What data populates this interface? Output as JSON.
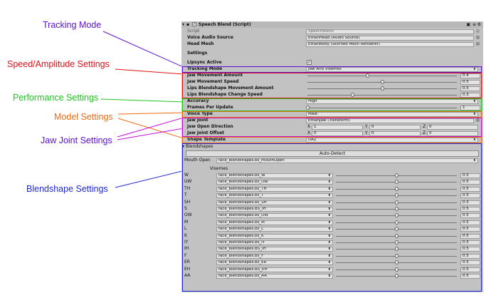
{
  "callouts": [
    {
      "id": "tracking",
      "text": "Tracking Mode",
      "color": "#5a0fd6"
    },
    {
      "id": "speed",
      "text": "Speed/Amplitude Settings",
      "color": "#e0121a"
    },
    {
      "id": "performance",
      "text": "Performance Settings",
      "color": "#21c421"
    },
    {
      "id": "model",
      "text": "Model Settings",
      "color": "#f06a11"
    },
    {
      "id": "jaw",
      "text": "Jaw Joint Settings",
      "color": "#5a0fd6"
    },
    {
      "id": "blend",
      "text": "Blendshape Settings",
      "color": "#1f2ad6"
    }
  ],
  "header": {
    "title": "Speech Blend (Script)",
    "enabled": true
  },
  "fields": {
    "script_label": "Script",
    "script_value": "SpeechBlend",
    "voice_source_label": "Voice Audio Source",
    "voice_source_value": "EthanHead (Audio Source)",
    "head_mesh_label": "Head Mesh",
    "head_mesh_value": "EthanBody (Skinned Mesh Renderer)",
    "settings_label": "Settings",
    "lipsync_label": "Lipsync Active",
    "lipsync_checked": true,
    "tracking_label": "Tracking Mode",
    "tracking_value": "Jaw And Visemes",
    "jaw_amount_label": "Jaw Movement Amount",
    "jaw_amount_value": "0.4",
    "jaw_speed_label": "Jaw Movement Speed",
    "jaw_speed_value": "0.5",
    "lips_amount_label": "Lips Blendshape Movement Amount",
    "lips_amount_value": "0.5",
    "lips_speed_label": "Lips Blendshape Change Speed",
    "lips_speed_value": "0.3",
    "accuracy_label": "Accuracy",
    "accuracy_value": "High",
    "frames_label": "Frames Per Update",
    "frames_value": "1",
    "voice_type_label": "Voice Type",
    "voice_type_value": "Male",
    "jaw_joint_label": "Jaw Joint",
    "jaw_joint_value": "EthanJaw (Transform)",
    "jaw_dir_label": "Jaw Open Direction",
    "jaw_dir_x": "1",
    "jaw_dir_y": "0",
    "jaw_dir_z": "0",
    "jaw_offset_label": "Jaw Joint Offset",
    "jaw_offset_x": "0",
    "jaw_offset_y": "0",
    "jaw_offset_z": "0",
    "shape_template_label": "Shape Template",
    "shape_template_value": "DAZ"
  },
  "blendshapes": {
    "foldout_label": "Blendshapes",
    "auto_detect_label": "Auto-Detect",
    "mouth_open_label": "Mouth Open",
    "mouth_open_value": "face_blendshapes.bs_mouthOpen",
    "visemes_label": "Visemes",
    "visemes": [
      {
        "name": "W",
        "shape": "face_blendshapes.bs_W",
        "value": "0.5"
      },
      {
        "name": "UW",
        "shape": "face_blendshapes.bs_UW",
        "value": "0.5"
      },
      {
        "name": "TH",
        "shape": "face_blendshapes.bs_TH",
        "value": "0.5"
      },
      {
        "name": "T",
        "shape": "face_blendshapes.bs_T",
        "value": "0.5"
      },
      {
        "name": "SH",
        "shape": "face_blendshapes.bs_SH",
        "value": "0.5"
      },
      {
        "name": "S",
        "shape": "face_blendshapes.BS_IH",
        "value": "0.5"
      },
      {
        "name": "OW",
        "shape": "face_blendshapes.bs_OW",
        "value": "0.5"
      },
      {
        "name": "M",
        "shape": "face_blendshapes.bs_M",
        "value": "0.5"
      },
      {
        "name": "L",
        "shape": "face_blendshapes.bs_L",
        "value": "0.5"
      },
      {
        "name": "K",
        "shape": "face_blendshapes.bs_K",
        "value": "0.5"
      },
      {
        "name": "IY",
        "shape": "face_blendshapes.bs_IY",
        "value": "0.5"
      },
      {
        "name": "IH",
        "shape": "face_blendshapes.BS_IH",
        "value": "0.5"
      },
      {
        "name": "F",
        "shape": "face_blendshapes.bs_F",
        "value": "0.5"
      },
      {
        "name": "ER",
        "shape": "face_blendshapes.bs_ER",
        "value": "0.5"
      },
      {
        "name": "EH",
        "shape": "face_blendshapes.BS_EH",
        "value": "0.5"
      },
      {
        "name": "AA",
        "shape": "face_blendshapes.bs_AA",
        "value": "0.5"
      }
    ]
  },
  "sliders": {
    "jaw_amount": 0.4,
    "jaw_speed": 0.5,
    "lips_amount": 0.5,
    "lips_speed": 0.3,
    "frames": 0.0,
    "viseme": 0.5
  }
}
